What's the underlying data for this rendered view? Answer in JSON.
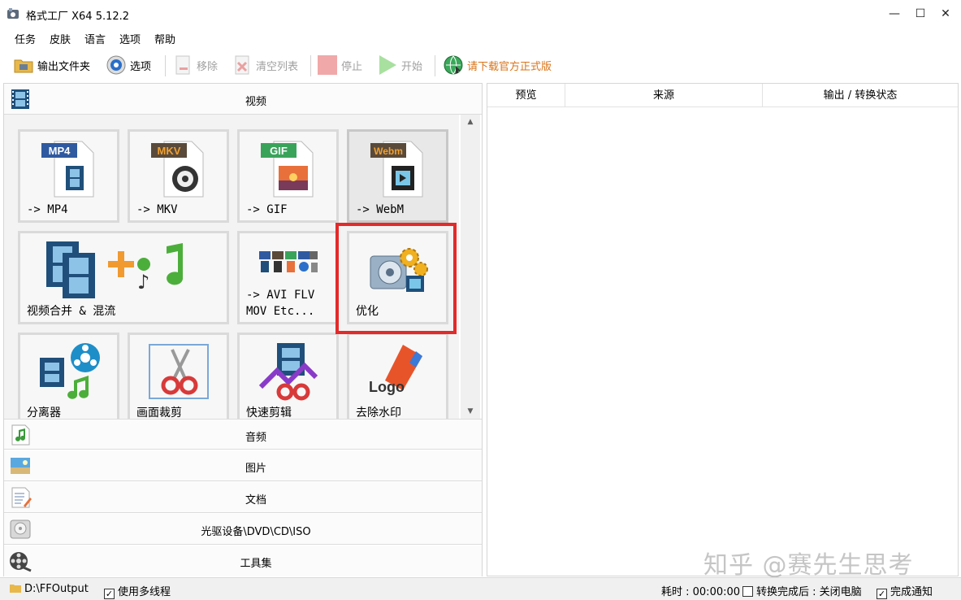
{
  "window": {
    "title": "格式工厂 X64 5.12.2",
    "minimize": "—",
    "maximize": "☐",
    "close": "✕"
  },
  "menu": [
    "任务",
    "皮肤",
    "语言",
    "选项",
    "帮助"
  ],
  "toolbar": {
    "output_folder": "输出文件夹",
    "options": "选项",
    "remove": "移除",
    "clear_list": "清空列表",
    "stop": "停止",
    "start": "开始",
    "download": "请下载官方正式版",
    "download_color": "#d9741a"
  },
  "categories": {
    "video": "视频",
    "audio": "音频",
    "picture": "图片",
    "document": "文档",
    "rom": "光驱设备\\DVD\\CD\\ISO",
    "tools": "工具集"
  },
  "tiles": [
    {
      "label": "-> MP4",
      "badge": "MP4",
      "badge_color": "#2f5aa0"
    },
    {
      "label": "-> MKV",
      "badge": "MKV",
      "badge_color": "#5a4a3a"
    },
    {
      "label": "-> GIF",
      "badge": "GIF",
      "badge_color": "#3aa35a"
    },
    {
      "label": "-> WebM",
      "badge": "Webm",
      "badge_color": "#d9741a"
    },
    {
      "label": "视频合并 & 混流"
    },
    {
      "label": "-> AVI FLV\nMOV Etc..."
    },
    {
      "label": "优化"
    },
    {
      "label": "分离器"
    },
    {
      "label": "画面裁剪"
    },
    {
      "label": "快速剪辑"
    },
    {
      "label": "去除水印",
      "logo_text": "Logo"
    }
  ],
  "right_columns": [
    "预览",
    "来源",
    "输出 / 转换状态"
  ],
  "watermark": "知乎 @赛先生思考",
  "status": {
    "output_path": "D:\\FFOutput",
    "multithread": "使用多线程",
    "multithread_checked": "✓",
    "elapsed": "耗时 : 00:00:00",
    "after_done": "转换完成后 : 关闭电脑",
    "notify": "完成通知",
    "notify_checked": "✓"
  },
  "highlight_color": "#e32a2a"
}
